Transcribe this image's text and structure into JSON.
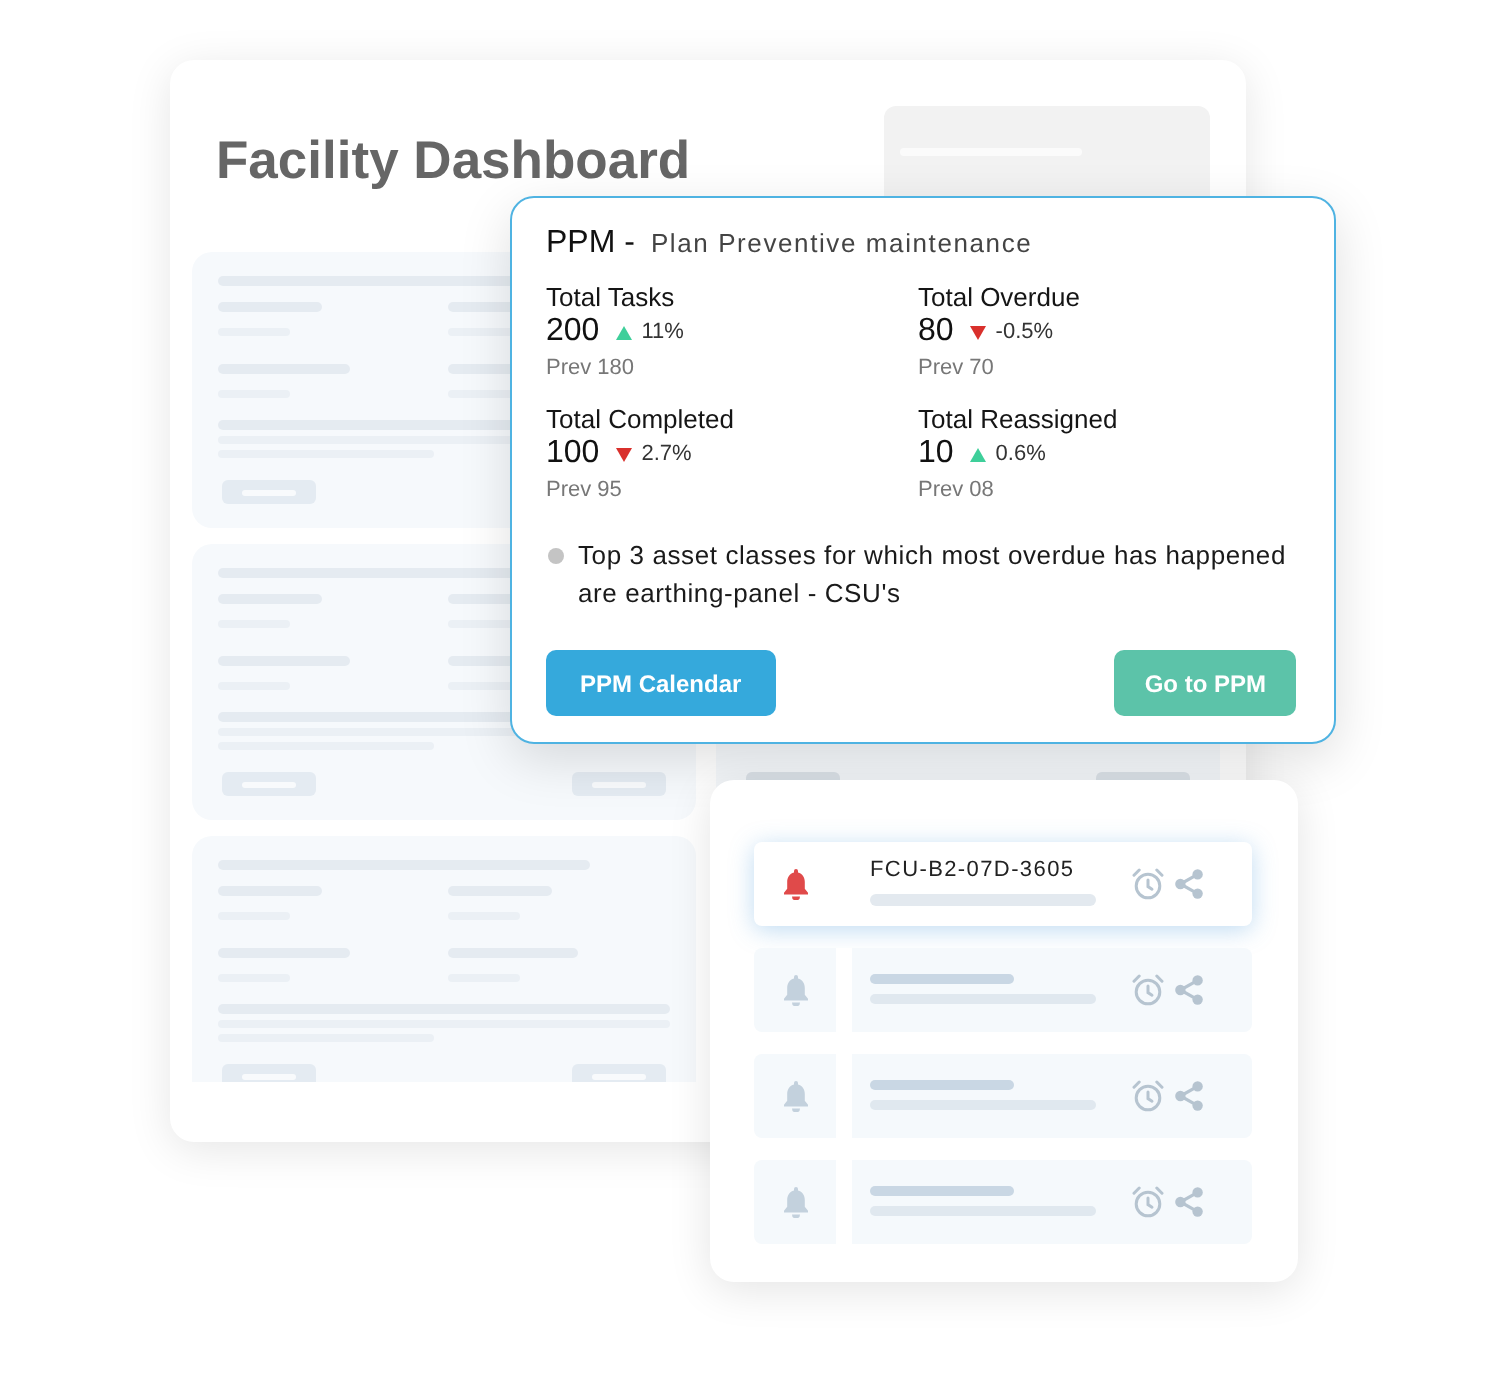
{
  "dashboard": {
    "title": "Facility Dashboard"
  },
  "ppm_card": {
    "title": "PPM -",
    "subtitle": "Plan Preventive maintenance",
    "stats": [
      {
        "label": "Total Tasks",
        "value": "200",
        "kind": "up",
        "change": "11%",
        "previous": "Prev 180"
      },
      {
        "label": "Total Overdue",
        "value": "80",
        "kind": "down",
        "change": "-0.5%",
        "previous": "Prev 70"
      },
      {
        "label": "Total Completed",
        "value": "100",
        "kind": "down",
        "change": "2.7%",
        "previous": "Prev 95"
      },
      {
        "label": "Total Reassigned",
        "value": "10",
        "kind": "up",
        "change": "0.6%",
        "previous": "Prev 08"
      }
    ],
    "insight": "Top 3 asset classes for which most overdue has happened are earthing-panel - CSU's",
    "buttons": [
      {
        "label": "PPM Calendar",
        "kind": "primary"
      },
      {
        "label": "Go to PPM",
        "kind": "secondary"
      }
    ]
  },
  "alerts": [
    {
      "code": "FCU-B2-07D-3605",
      "selected": true
    },
    {
      "selected": false
    },
    {
      "selected": false
    },
    {
      "selected": false
    }
  ]
}
